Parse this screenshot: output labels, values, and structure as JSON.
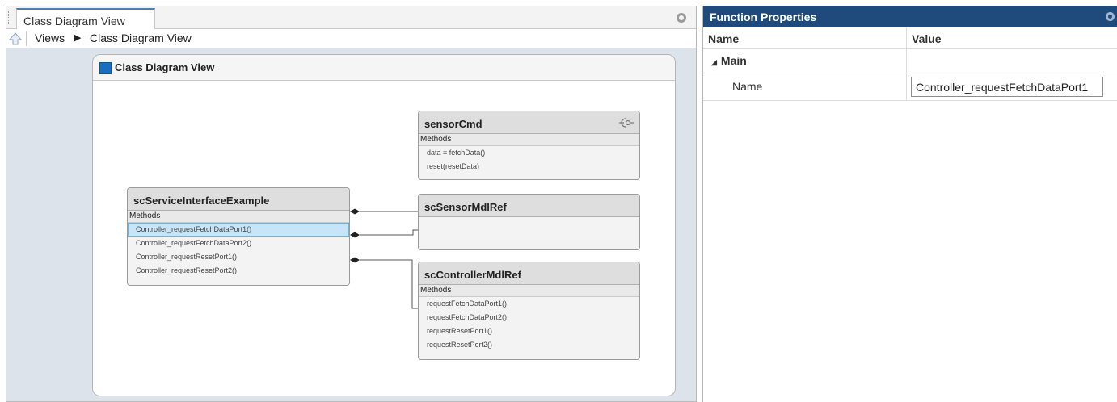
{
  "left_pane": {
    "tab_label": "Class Diagram View",
    "breadcrumb": {
      "root": "Views",
      "current": "Class Diagram View"
    }
  },
  "diagram": {
    "title": "Class Diagram View",
    "classes": {
      "sensor_cmd": {
        "name": "sensorCmd",
        "section": "Methods",
        "methods": [
          "data = fetchData()",
          "reset(resetData)"
        ]
      },
      "service": {
        "name": "scServiceInterfaceExample",
        "section": "Methods",
        "methods": [
          "Controller_requestFetchDataPort1()",
          "Controller_requestFetchDataPort2()",
          "Controller_requestResetPort1()",
          "Controller_requestResetPort2()"
        ],
        "selected_method": "Controller_requestFetchDataPort1()"
      },
      "sensor_mdl": {
        "name": "scSensorMdlRef"
      },
      "controller_mdl": {
        "name": "scControllerMdlRef",
        "section": "Methods",
        "methods": [
          "requestFetchDataPort1()",
          "requestFetchDataPort2()",
          "requestResetPort1()",
          "requestResetPort2()"
        ]
      }
    }
  },
  "properties": {
    "title": "Function Properties",
    "columns": {
      "name": "Name",
      "value": "Value"
    },
    "group": "Main",
    "field_label": "Name",
    "field_value": "Controller_requestFetchDataPort1"
  },
  "icons": {
    "up": "up-arrow-icon",
    "breadcrumb_sep": "triangle-right-icon",
    "diagram": "square-icon",
    "interface": "interface-lollipop-icon",
    "expand": "triangle-down-icon"
  },
  "colors": {
    "accent": "#1e4a7c",
    "selection": "#c7e5f9",
    "diagram_icon": "#1a6ec2"
  }
}
